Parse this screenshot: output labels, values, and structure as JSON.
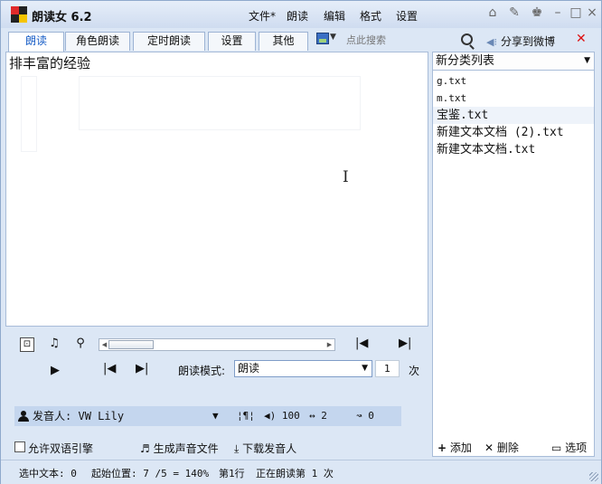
{
  "app": {
    "title": "朗读女 6.2"
  },
  "menu": {
    "file": "文件*",
    "read": "朗读",
    "edit": "编辑",
    "format": "格式",
    "settings": "设置"
  },
  "window_controls": {
    "home": "⌂",
    "brush": "✎",
    "shirt": "♚",
    "minimize": "–",
    "maximize": "□",
    "close": "×"
  },
  "tabs": [
    "朗读",
    "角色朗读",
    "定时朗读",
    "设置",
    "其他"
  ],
  "search": {
    "placeholder": "点此搜索"
  },
  "share": {
    "label": "分享到微博"
  },
  "editor": {
    "text": "排丰富的经验",
    "cursor": "I"
  },
  "side": {
    "category": "新分类列表",
    "files": [
      "g.txt",
      "m.txt",
      "宝鉴.txt",
      "新建文本文档 (2).txt",
      "新建文本文档.txt"
    ],
    "actions": {
      "add": "添加",
      "delete": "删除",
      "options": "选项"
    }
  },
  "controls": {
    "mode_label": "朗读模式:",
    "mode_value": "朗读",
    "repeat_count": "1",
    "repeat_unit": "次",
    "voice_label": "发音人:",
    "voice_value": "VW Lily",
    "volume": "100",
    "speed": "2",
    "pitch": "0",
    "bilingual": "允许双语引擎",
    "generate_audio": "生成声音文件",
    "download_voice": "下载发音人"
  },
  "status": {
    "selected": "选中文本: 0",
    "start": "起始位置: 7 /5 = 140%",
    "line": "第1行",
    "reading": "正在朗读第 1 次"
  }
}
